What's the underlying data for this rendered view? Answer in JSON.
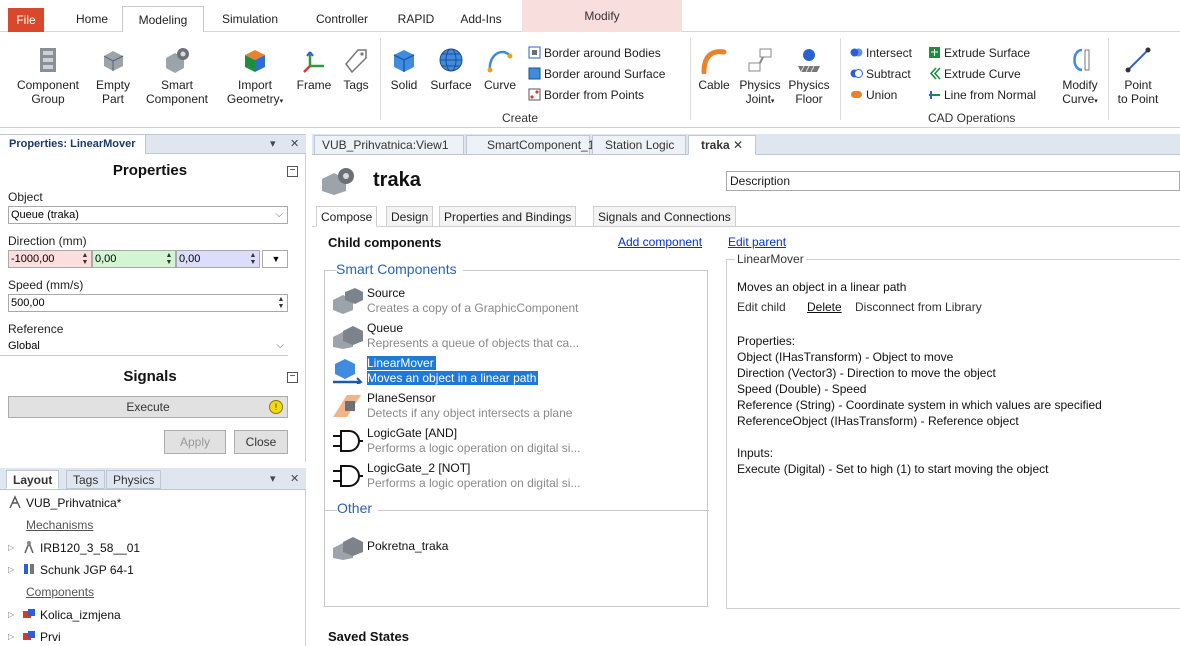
{
  "ribbon_tabs": [
    "File",
    "Home",
    "Modeling",
    "Simulation",
    "Controller",
    "RAPID",
    "Add-Ins",
    "Modify"
  ],
  "ribbon": {
    "component_group": [
      "Component",
      "Group"
    ],
    "empty_part": [
      "Empty",
      "Part"
    ],
    "smart_component": [
      "Smart",
      "Component"
    ],
    "import_geometry": [
      "Import",
      "Geometry"
    ],
    "frame": "Frame",
    "tags": "Tags",
    "solid": "Solid",
    "surface": "Surface",
    "curve": "Curve",
    "border_bodies": "Border around Bodies",
    "border_surface": "Border around Surface",
    "border_points": "Border from Points",
    "create_label": "Create",
    "cable": "Cable",
    "physics_joint": [
      "Physics",
      "Joint"
    ],
    "physics_floor": [
      "Physics",
      "Floor"
    ],
    "intersect": "Intersect",
    "subtract": "Subtract",
    "union": "Union",
    "extrude_surface": "Extrude Surface",
    "extrude_curve": "Extrude Curve",
    "line_from_normal": "Line from Normal",
    "modify_curve": [
      "Modify",
      "Curve"
    ],
    "cad_label": "CAD Operations",
    "point_to_point": [
      "Point",
      "to Point"
    ]
  },
  "properties": {
    "panel_title": "Properties: LinearMover",
    "section_properties": "Properties",
    "object_label": "Object",
    "object_value": "Queue (traka)",
    "direction_label": "Direction (mm)",
    "dir_x": "-1000,00",
    "dir_y": "0,00",
    "dir_z": "0,00",
    "speed_label": "Speed (mm/s)",
    "speed_value": "500,00",
    "reference_label": "Reference",
    "reference_value": "Global",
    "section_signals": "Signals",
    "execute_label": "Execute",
    "apply": "Apply",
    "close": "Close"
  },
  "layout": {
    "tabs": [
      "Layout",
      "Tags",
      "Physics"
    ],
    "station": "VUB_Prihvatnica*",
    "mechanisms_label": "Mechanisms",
    "mech1": "IRB120_3_58__01",
    "mech2": "Schunk JGP 64-1",
    "components_label": "Components",
    "comp1": "Kolica_izmjena",
    "comp2": "Prvi"
  },
  "doc_tabs": [
    "VUB_Prihvatnica:View1",
    "SmartComponent_1",
    "Station Logic",
    "traka"
  ],
  "editor": {
    "title": "traka",
    "description": "Description",
    "subtabs": [
      "Compose",
      "Design",
      "Properties and Bindings",
      "Signals and Connections"
    ],
    "child_components": "Child components",
    "add_component": "Add component",
    "edit_parent": "Edit parent",
    "smart_components": "Smart Components",
    "other": "Other",
    "saved_states": "Saved States",
    "items": [
      {
        "name": "Source",
        "desc": "Creates a copy of a GraphicComponent"
      },
      {
        "name": "Queue",
        "desc": "Represents a queue of objects that ca..."
      },
      {
        "name": "LinearMover",
        "desc": "Moves an object in a linear path"
      },
      {
        "name": "PlaneSensor",
        "desc": "Detects if any object intersects a plane"
      },
      {
        "name": "LogicGate [AND]",
        "desc": "Performs a logic operation on digital si..."
      },
      {
        "name": "LogicGate_2 [NOT]",
        "desc": "Performs a logic operation on digital si..."
      }
    ],
    "other_item": "Pokretna_traka",
    "detail": {
      "title": "LinearMover",
      "summary": "Moves an object in a linear path",
      "edit_child": "Edit child",
      "delete": "Delete",
      "disconnect": "Disconnect from Library",
      "properties_header": "Properties:",
      "props": [
        "Object (IHasTransform) - Object to move",
        "Direction (Vector3) - Direction to move the object",
        "Speed (Double) - Speed",
        "Reference (String) - Coordinate system in which values are specified",
        "ReferenceObject (IHasTransform) - Reference object"
      ],
      "inputs_header": "Inputs:",
      "inputs": [
        "Execute (Digital) - Set to high (1) to start moving the object"
      ]
    }
  },
  "colors": {
    "file_tab": "#d9482c",
    "selection": "#1e7ad6",
    "dir_x_bg": "#fddede",
    "dir_y_bg": "#d4f5d4",
    "dir_z_bg": "#dcdcfb",
    "link": "#0033cc",
    "group_title": "#2e62b5"
  }
}
